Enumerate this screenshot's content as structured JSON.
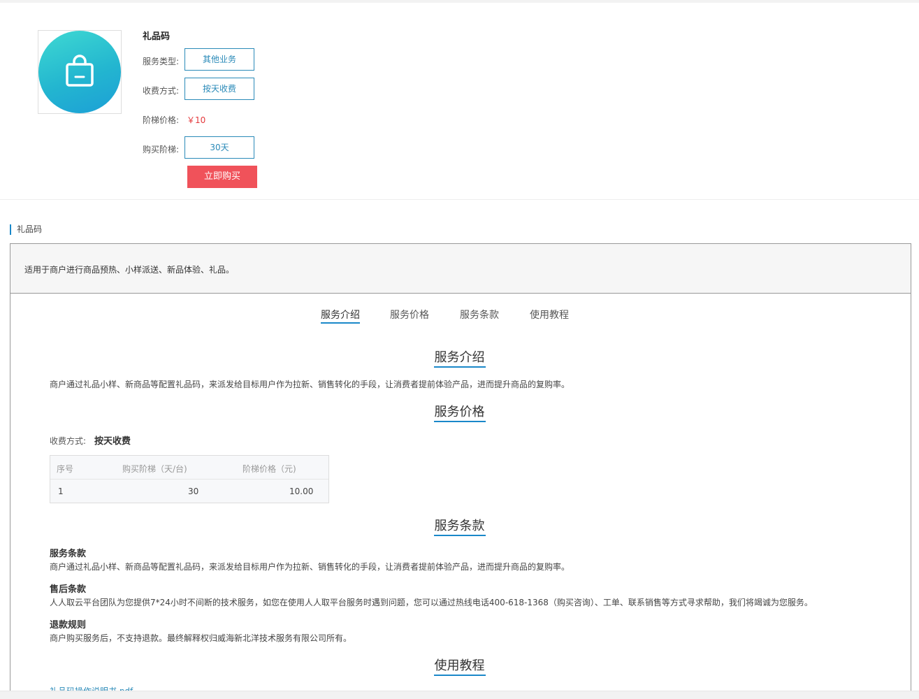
{
  "product": {
    "name": "礼品码",
    "service_type_label": "服务类型:",
    "service_type_value": "其他业务",
    "billing_label": "收费方式:",
    "billing_value": "按天收费",
    "price_label": "阶梯价格:",
    "price_value": "￥10",
    "tier_label": "购买阶梯:",
    "tier_value": "30天",
    "buy_label": "立即购买",
    "icon": "shopping-bag-icon",
    "colors": {
      "accent": "#1a88c9",
      "buy": "#f0525a",
      "price": "#e4393c"
    }
  },
  "section_title": "礼品码",
  "summary": "适用于商户进行商品预热、小样派送、新品体验、礼品。",
  "tabs": [
    {
      "label": "服务介绍",
      "active": true
    },
    {
      "label": "服务价格",
      "active": false
    },
    {
      "label": "服务条款",
      "active": false
    },
    {
      "label": "使用教程",
      "active": false
    }
  ],
  "intro": {
    "heading": "服务介绍",
    "text": "商户通过礼品小样、新商品等配置礼品码，来派发给目标用户作为拉新、销售转化的手段，让消费者提前体验产品，进而提升商品的复购率。"
  },
  "pricing": {
    "heading": "服务价格",
    "fee_label": "收费方式:",
    "fee_value": "按天收费",
    "table": {
      "headers": [
        "序号",
        "购买阶梯（天/台)",
        "阶梯价格（元)"
      ],
      "rows": [
        [
          "1",
          "30",
          "10.00"
        ]
      ]
    }
  },
  "terms": {
    "heading": "服务条款",
    "items": [
      {
        "title": "服务条款",
        "text": "商户通过礼品小样、新商品等配置礼品码，来派发给目标用户作为拉新、销售转化的手段，让消费者提前体验产品，进而提升商品的复购率。"
      },
      {
        "title": "售后条款",
        "text": "人人取云平台团队为您提供7*24小时不间断的技术服务，如您在使用人人取平台服务时遇到问题，您可以通过热线电话400-618-1368（购买咨询）、工单、联系销售等方式寻求帮助，我们将竭诚为您服务。"
      },
      {
        "title": "退款规则",
        "text": "商户购买服务后，不支持退款。最终解释权归威海新北洋技术服务有限公司所有。"
      }
    ]
  },
  "tutorial": {
    "heading": "使用教程",
    "link": "礼品码操作说明书.pdf"
  }
}
